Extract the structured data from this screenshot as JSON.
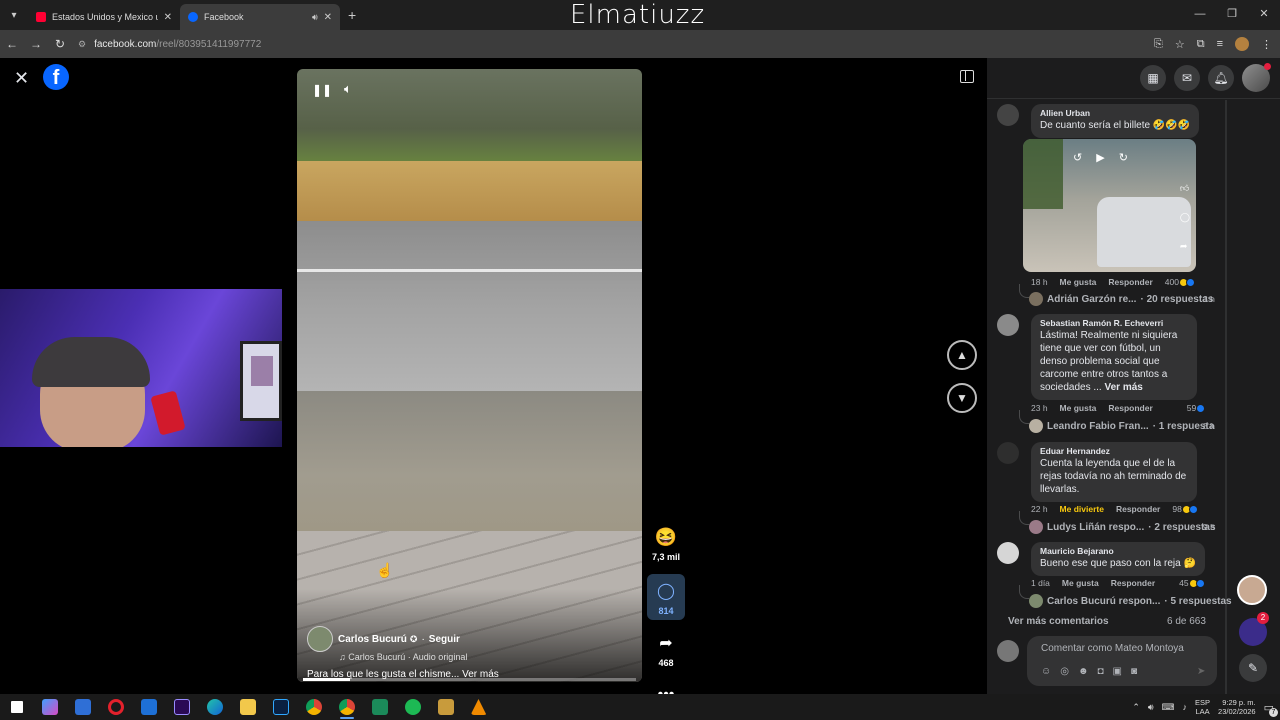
{
  "browser": {
    "tabs": [
      {
        "title": "Estados Unidos y Mexico unier",
        "favicon_color": "#ff0033",
        "active": false
      },
      {
        "title": "Facebook",
        "favicon_color": "#0866ff",
        "active": true
      }
    ],
    "overlay_brand": "Elmatiuzz",
    "url_host": "facebook.com",
    "url_path": "/reel/803951411997772"
  },
  "viewer": {
    "logo": "f",
    "reel": {
      "author": "Carlos Bucurú",
      "follow_label": "Seguir",
      "audio": "Carlos Bucurú · Audio original",
      "caption": "Para los que les gusta el chisme... Ver más",
      "progress": 0.14
    },
    "actions": {
      "reactions_count": "7,3 mil",
      "comments_count": "814",
      "shares_count": "468"
    }
  },
  "comments": [
    {
      "name": "Allien Urban",
      "text": "De cuanto sería el billete 🤣🤣🤣",
      "age": "18 h",
      "like_label": "Me gusta",
      "reply_label": "Responder",
      "reactions": "400",
      "reply_summary": {
        "name": "Adrián Garzón re...",
        "count": "· 20 respuestas",
        "age": "3 h"
      },
      "gif_labels": {
        "likes": "444",
        "comments": "11"
      }
    },
    {
      "name": "Sebastian Ramón R. Echeverri",
      "text": "Lástima! Realmente ni siquiera tiene que ver con fútbol, un denso problema social que carcome entre otros tantos a sociedades ...",
      "more": "Ver más",
      "age": "23 h",
      "like_label": "Me gusta",
      "reply_label": "Responder",
      "reactions": "59",
      "reply_summary": {
        "name": "Leandro Fabio Fran...",
        "count": "· 1 respuesta",
        "age": "8 h"
      }
    },
    {
      "name": "Eduar Hernandez",
      "text": "Cuenta la leyenda que el de la rejas todavía no ah terminado de llevarlas.",
      "age": "22 h",
      "like_label": "Me divierte",
      "reply_label": "Responder",
      "reactions": "98",
      "reply_summary": {
        "name": "Ludys Liñán respo...",
        "count": "· 2 respuestas",
        "age": "9 h"
      }
    },
    {
      "name": "Mauricio Bejarano",
      "text": "Bueno ese que paso con la reja 🤔",
      "age": "1 día",
      "like_label": "Me gusta",
      "reply_label": "Responder",
      "reactions": "45",
      "reply_summary": {
        "name": "Carlos Bucurú respon...",
        "count": "· 5 respuestas",
        "age": ""
      }
    }
  ],
  "comments_footer": {
    "more_label": "Ver más comentarios",
    "page_count": "6 de 663",
    "compose_placeholder": "Comentar como Mateo Montoya"
  },
  "side_chat_badge": "2",
  "taskbar": {
    "lang_top": "ESP",
    "lang_bottom": "LAA",
    "time": "9:29 p. m.",
    "date": "23/02/2026",
    "notif_count": "7"
  },
  "colors": {
    "accent": "#0866ff",
    "pane_bg": "#1c1c1d",
    "bubble_bg": "#333334",
    "divierte": "#f7c80e"
  }
}
